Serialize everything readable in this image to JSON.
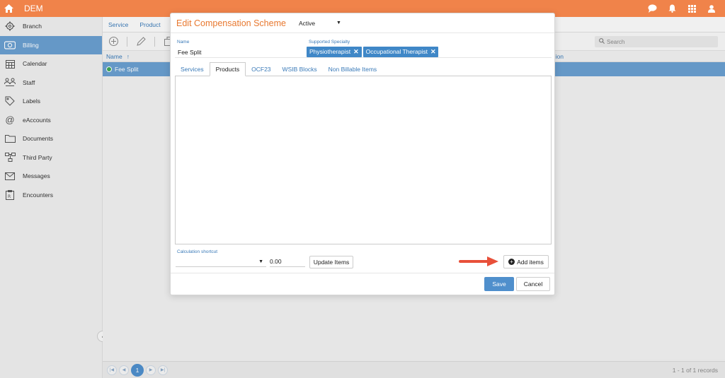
{
  "app": {
    "title": "DEM"
  },
  "sidebar": {
    "items": [
      {
        "label": "Branch",
        "icon": "gear-icon",
        "active": false
      },
      {
        "label": "Billing",
        "icon": "billing-icon",
        "active": true
      },
      {
        "label": "Calendar",
        "icon": "calendar-icon",
        "active": false
      },
      {
        "label": "Staff",
        "icon": "staff-icon",
        "active": false
      },
      {
        "label": "Labels",
        "icon": "tag-icon",
        "active": false
      },
      {
        "label": "eAccounts",
        "icon": "at-icon",
        "active": false
      },
      {
        "label": "Documents",
        "icon": "folder-icon",
        "active": false
      },
      {
        "label": "Third Party",
        "icon": "network-icon",
        "active": false
      },
      {
        "label": "Messages",
        "icon": "envelope-icon",
        "active": false
      },
      {
        "label": "Encounters",
        "icon": "clipboard-icon",
        "active": false
      }
    ]
  },
  "main": {
    "subnav": [
      "Service",
      "Product"
    ],
    "search_placeholder": "Search",
    "grid": {
      "name_header": "Name",
      "sort_indicator": "↑",
      "right_header_fragment": "ion",
      "rows": [
        {
          "name": "Fee Split",
          "status": "active"
        }
      ]
    },
    "pager": {
      "current_page": "1",
      "records": "1 - 1 of 1 records"
    }
  },
  "dialog": {
    "title": "Edit Compensation Scheme",
    "status": "Active",
    "name_label": "Name",
    "name_value": "Fee Split",
    "specialty_label": "Supported Specialty",
    "specialties": [
      "Physiotherapist",
      "Occupational Therapist"
    ],
    "tabs": [
      {
        "label": "Services",
        "active": false
      },
      {
        "label": "Products",
        "active": true
      },
      {
        "label": "OCF23",
        "active": false
      },
      {
        "label": "WSIB Blocks",
        "active": false
      },
      {
        "label": "Non Billable Items",
        "active": false
      }
    ],
    "calc_label": "Calculation shortcut",
    "calc_value": "0.00",
    "update_label": "Update Items",
    "add_label": "Add items",
    "save_label": "Save",
    "cancel_label": "Cancel"
  },
  "colors": {
    "topbar": "#f0834a",
    "accent_blue": "#4f8fcc",
    "title_orange": "#e8782f",
    "annotation_arrow": "#e8503a"
  }
}
